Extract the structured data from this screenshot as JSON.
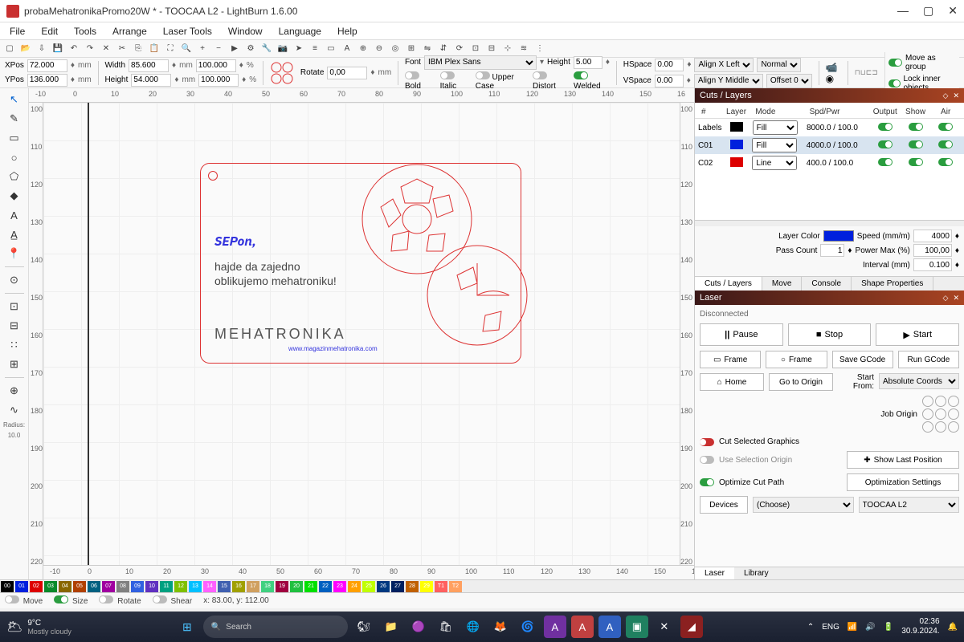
{
  "title": "probaMehatronikaPromo20W * - TOOCAA L2 - LightBurn 1.6.00",
  "menu": [
    "File",
    "Edit",
    "Tools",
    "Arrange",
    "Laser Tools",
    "Window",
    "Language",
    "Help"
  ],
  "props": {
    "xpos_label": "XPos",
    "xpos": "72.000",
    "ypos_label": "YPos",
    "ypos": "136.000",
    "width_label": "Width",
    "width": "85.600",
    "w100": "100.000",
    "height_label": "Height",
    "height": "54.000",
    "h100": "100.000",
    "mm": "mm",
    "pct": "%",
    "rotate_label": "Rotate",
    "rotate": "0,00",
    "font_label": "Font",
    "font": "IBM Plex Sans",
    "fheight_label": "Height",
    "fheight": "5.00",
    "hspace_label": "HSpace",
    "hspace": "0.00",
    "vspace_label": "VSpace",
    "vspace": "0.00",
    "bold": "Bold",
    "italic": "Italic",
    "upper": "Upper Case",
    "distort": "Distort",
    "welded": "Welded",
    "alignx": "Align X Left",
    "aligny": "Align Y Middle",
    "normal": "Normal",
    "offset": "Offset 0",
    "movegrp": "Move as group",
    "locklbl": "Lock inner objects"
  },
  "radius": {
    "label": "Radius:",
    "val": "10.0"
  },
  "ruler_x": [
    "-10",
    "0",
    "10",
    "20",
    "30",
    "40",
    "50",
    "60",
    "70",
    "80",
    "90",
    "100",
    "110",
    "120",
    "130",
    "140",
    "150",
    "16"
  ],
  "ruler_y": [
    "100",
    "110",
    "120",
    "130",
    "140",
    "150",
    "160",
    "170",
    "180",
    "190",
    "200",
    "210",
    "220"
  ],
  "ruler_r": [
    "100",
    "110",
    "120",
    "130",
    "140",
    "150",
    "160",
    "170",
    "180",
    "190",
    "200",
    "210",
    "220"
  ],
  "design": {
    "t1": "SEPon,",
    "t2a": "hajde da zajedno",
    "t2b": "oblikujemo mehatroniku!",
    "logo": "MEHATRONIKA",
    "url": "www.magazinmehatronika.com"
  },
  "cuts": {
    "title": "Cuts / Layers",
    "hdr": {
      "num": "#",
      "layer": "Layer",
      "mode": "Mode",
      "spd": "Spd/Pwr",
      "out": "Output",
      "show": "Show",
      "air": "Air"
    },
    "rows": [
      {
        "name": "Labels",
        "color": "#000",
        "mode": "Fill",
        "spd": "8000.0 / 100.0"
      },
      {
        "name": "C01",
        "color": "#0020dd",
        "mode": "Fill",
        "spd": "4000.0 / 100.0",
        "sel": true
      },
      {
        "name": "C02",
        "color": "#d00",
        "mode": "Line",
        "spd": "400.0 / 100.0"
      }
    ],
    "layer_color": "Layer Color",
    "speed_lbl": "Speed (mm/m)",
    "speed": "4000",
    "pass_lbl": "Pass Count",
    "pass": "1",
    "pmax_lbl": "Power Max (%)",
    "pmax": "100,00",
    "interval_lbl": "Interval (mm)",
    "interval": "0.100",
    "tabs": [
      "Cuts / Layers",
      "Move",
      "Console",
      "Shape Properties"
    ]
  },
  "laser": {
    "title": "Laser",
    "status": "Disconnected",
    "pause": "Pause",
    "stop": "Stop",
    "start": "Start",
    "frame1": "Frame",
    "frame2": "Frame",
    "savegc": "Save GCode",
    "rungc": "Run GCode",
    "home": "Home",
    "goto": "Go to Origin",
    "startfrom_lbl": "Start From:",
    "startfrom": "Absolute Coords",
    "joborigin": "Job Origin",
    "cutsel": "Cut Selected Graphics",
    "useselorig": "Use Selection Origin",
    "optpath": "Optimize Cut Path",
    "showlast": "Show Last Position",
    "optset": "Optimization Settings",
    "devices": "Devices",
    "choose": "(Choose)",
    "devname": "TOOCAA L2",
    "tabs": [
      "Laser",
      "Library"
    ]
  },
  "colorswatches": [
    {
      "c": "#000",
      "n": "00"
    },
    {
      "c": "#0020dd",
      "n": "01"
    },
    {
      "c": "#d00",
      "n": "02"
    },
    {
      "c": "#0a8a2a",
      "n": "03"
    },
    {
      "c": "#886600",
      "n": "04"
    },
    {
      "c": "#b04000",
      "n": "05"
    },
    {
      "c": "#006080",
      "n": "06"
    },
    {
      "c": "#a000a0",
      "n": "07"
    },
    {
      "c": "#808080",
      "n": "08"
    },
    {
      "c": "#3060e0",
      "n": "09"
    },
    {
      "c": "#6030c0",
      "n": "10"
    },
    {
      "c": "#00a080",
      "n": "11"
    },
    {
      "c": "#80c000",
      "n": "12"
    },
    {
      "c": "#00c0ff",
      "n": "13"
    },
    {
      "c": "#ff60ff",
      "n": "14"
    },
    {
      "c": "#4060b0",
      "n": "15"
    },
    {
      "c": "#a0a000",
      "n": "16"
    },
    {
      "c": "#d0a060",
      "n": "17"
    },
    {
      "c": "#40d080",
      "n": "18"
    },
    {
      "c": "#a00040",
      "n": "19"
    },
    {
      "c": "#20c040",
      "n": "20"
    },
    {
      "c": "#00e000",
      "n": "21"
    },
    {
      "c": "#0060c0",
      "n": "22"
    },
    {
      "c": "#ff00ff",
      "n": "23"
    },
    {
      "c": "#ffa000",
      "n": "24"
    },
    {
      "c": "#c0ff00",
      "n": "25"
    },
    {
      "c": "#003880",
      "n": "26"
    },
    {
      "c": "#002060",
      "n": "27"
    },
    {
      "c": "#c06000",
      "n": "28"
    },
    {
      "c": "#ffff00",
      "n": "29"
    },
    {
      "c": "#ff6060",
      "n": "T1"
    },
    {
      "c": "#ffa060",
      "n": "T2"
    }
  ],
  "status": {
    "move": "Move",
    "size": "Size",
    "rotate": "Rotate",
    "shear": "Shear",
    "coords": "x: 83.00, y: 112.00"
  },
  "taskbar": {
    "temp": "9°C",
    "weather": "Mostly cloudy",
    "search": "Search",
    "lang": "ENG",
    "time": "02:36",
    "date": "30.9.2024."
  }
}
